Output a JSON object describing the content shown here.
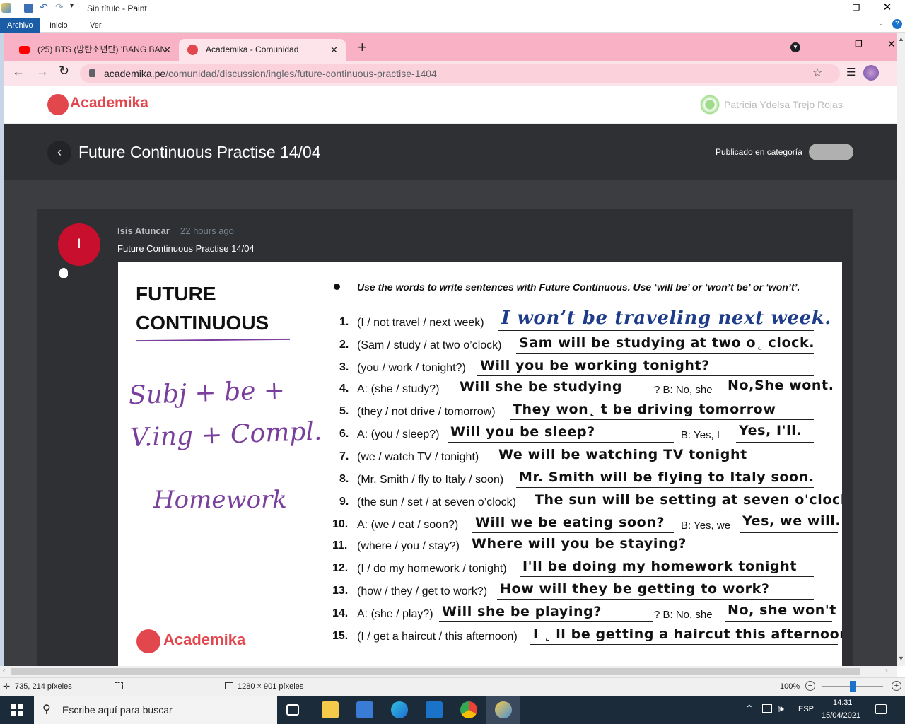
{
  "paint": {
    "title": "Sin título - Paint",
    "tabs": [
      "Archivo",
      "Inicio",
      "Ver"
    ],
    "status_cursor": "735, 214 píxeles",
    "status_size": "1280 × 901 píxeles",
    "zoom": "100%"
  },
  "browser": {
    "tabs": [
      {
        "label": "(25) BTS (방탄소년단) 'BANG BAN",
        "icon": "youtube-icon"
      },
      {
        "label": "Academika - Comunidad",
        "icon": "academika-icon"
      }
    ],
    "url_host": "academika.pe",
    "url_path": "/comunidad/discussion/ingles/future-continuous-practise-1404"
  },
  "site": {
    "logo": "Academika",
    "user_name": "Patricia Ydelsa Trejo Rojas",
    "page_title": "Future Continuous Practise 14/04",
    "published_label": "Publicado en categoría"
  },
  "post": {
    "avatar_letter": "I",
    "author": "Isis Atuncar",
    "time": "22 hours ago",
    "body": "Future Continuous Practise 14/04"
  },
  "worksheet": {
    "title_line1": "FUTURE",
    "title_line2": "CONTINUOUS",
    "instruction": "Use the words to write sentences with Future Continuous.  Use ‘will be’ or ‘won’t be’ or ‘won’t’.",
    "handwritten_formula": "Subj + be + V.ing + Compl.",
    "handwritten_note": "Homework",
    "logo": "Academika",
    "exercises": [
      {
        "num": "1.",
        "prompt": "(I / not travel / next week)",
        "answer": "I won’t be traveling next week."
      },
      {
        "num": "2.",
        "prompt": "(Sam / study / at two o’clock)",
        "answer": "Sam will be studying at two o˛ clock."
      },
      {
        "num": "3.",
        "prompt": "(you / work / tonight?)",
        "answer": "Will you be working tonight?"
      },
      {
        "num": "4.",
        "prompt": "A: (she / study?)",
        "answer": "Will she be studying",
        "suffix": "?  B: No, she",
        "answer2": "No,She wont."
      },
      {
        "num": "5.",
        "prompt": "(they / not drive / tomorrow)",
        "answer": "They won˛ t be driving tomorrow"
      },
      {
        "num": "6.",
        "prompt": "A: (you / sleep?)",
        "answer": "Will you be sleep?",
        "suffix": "B: Yes, I",
        "answer2": "Yes, I'll."
      },
      {
        "num": "7.",
        "prompt": "(we / watch TV / tonight)",
        "answer": "We will be watching TV tonight"
      },
      {
        "num": "8.",
        "prompt": "(Mr. Smith / fly to Italy / soon)",
        "answer": "Mr. Smith will be flying to Italy soon."
      },
      {
        "num": "9.",
        "prompt": "(the sun / set / at seven o’clock)",
        "answer": "The sun will be setting at seven o'clock."
      },
      {
        "num": "10.",
        "prompt": "A: (we / eat / soon?)",
        "answer": "Will we be eating soon?",
        "suffix": "B: Yes, we",
        "answer2": "Yes, we will."
      },
      {
        "num": "11.",
        "prompt": "(where / you / stay?)",
        "answer": "Where will you be staying?"
      },
      {
        "num": "12.",
        "prompt": "(I / do my homework / tonight)",
        "answer": "I'll be doing my homework tonight"
      },
      {
        "num": "13.",
        "prompt": "(how / they / get to work?)",
        "answer": "How will they be getting to work?"
      },
      {
        "num": "14.",
        "prompt": "A: (she / play?)",
        "answer": "Will she be playing?",
        "suffix": "?  B: No, she",
        "answer2": "No, she won't"
      },
      {
        "num": "15.",
        "prompt": "(I / get a haircut / this afternoon)",
        "answer": "I ˛ ll be getting a haircut this afternoon."
      }
    ]
  },
  "taskbar": {
    "search_placeholder": "Escribe aquí para buscar",
    "lang": "ESP",
    "time": "14:31",
    "date": "15/04/2021"
  },
  "colors": {
    "brand": "#e2474e",
    "tab_bar": "#f9b2c5",
    "avatar": "#c8102e",
    "handwriting": "#7a3f9d",
    "first_answer": "#1f3c8a"
  }
}
